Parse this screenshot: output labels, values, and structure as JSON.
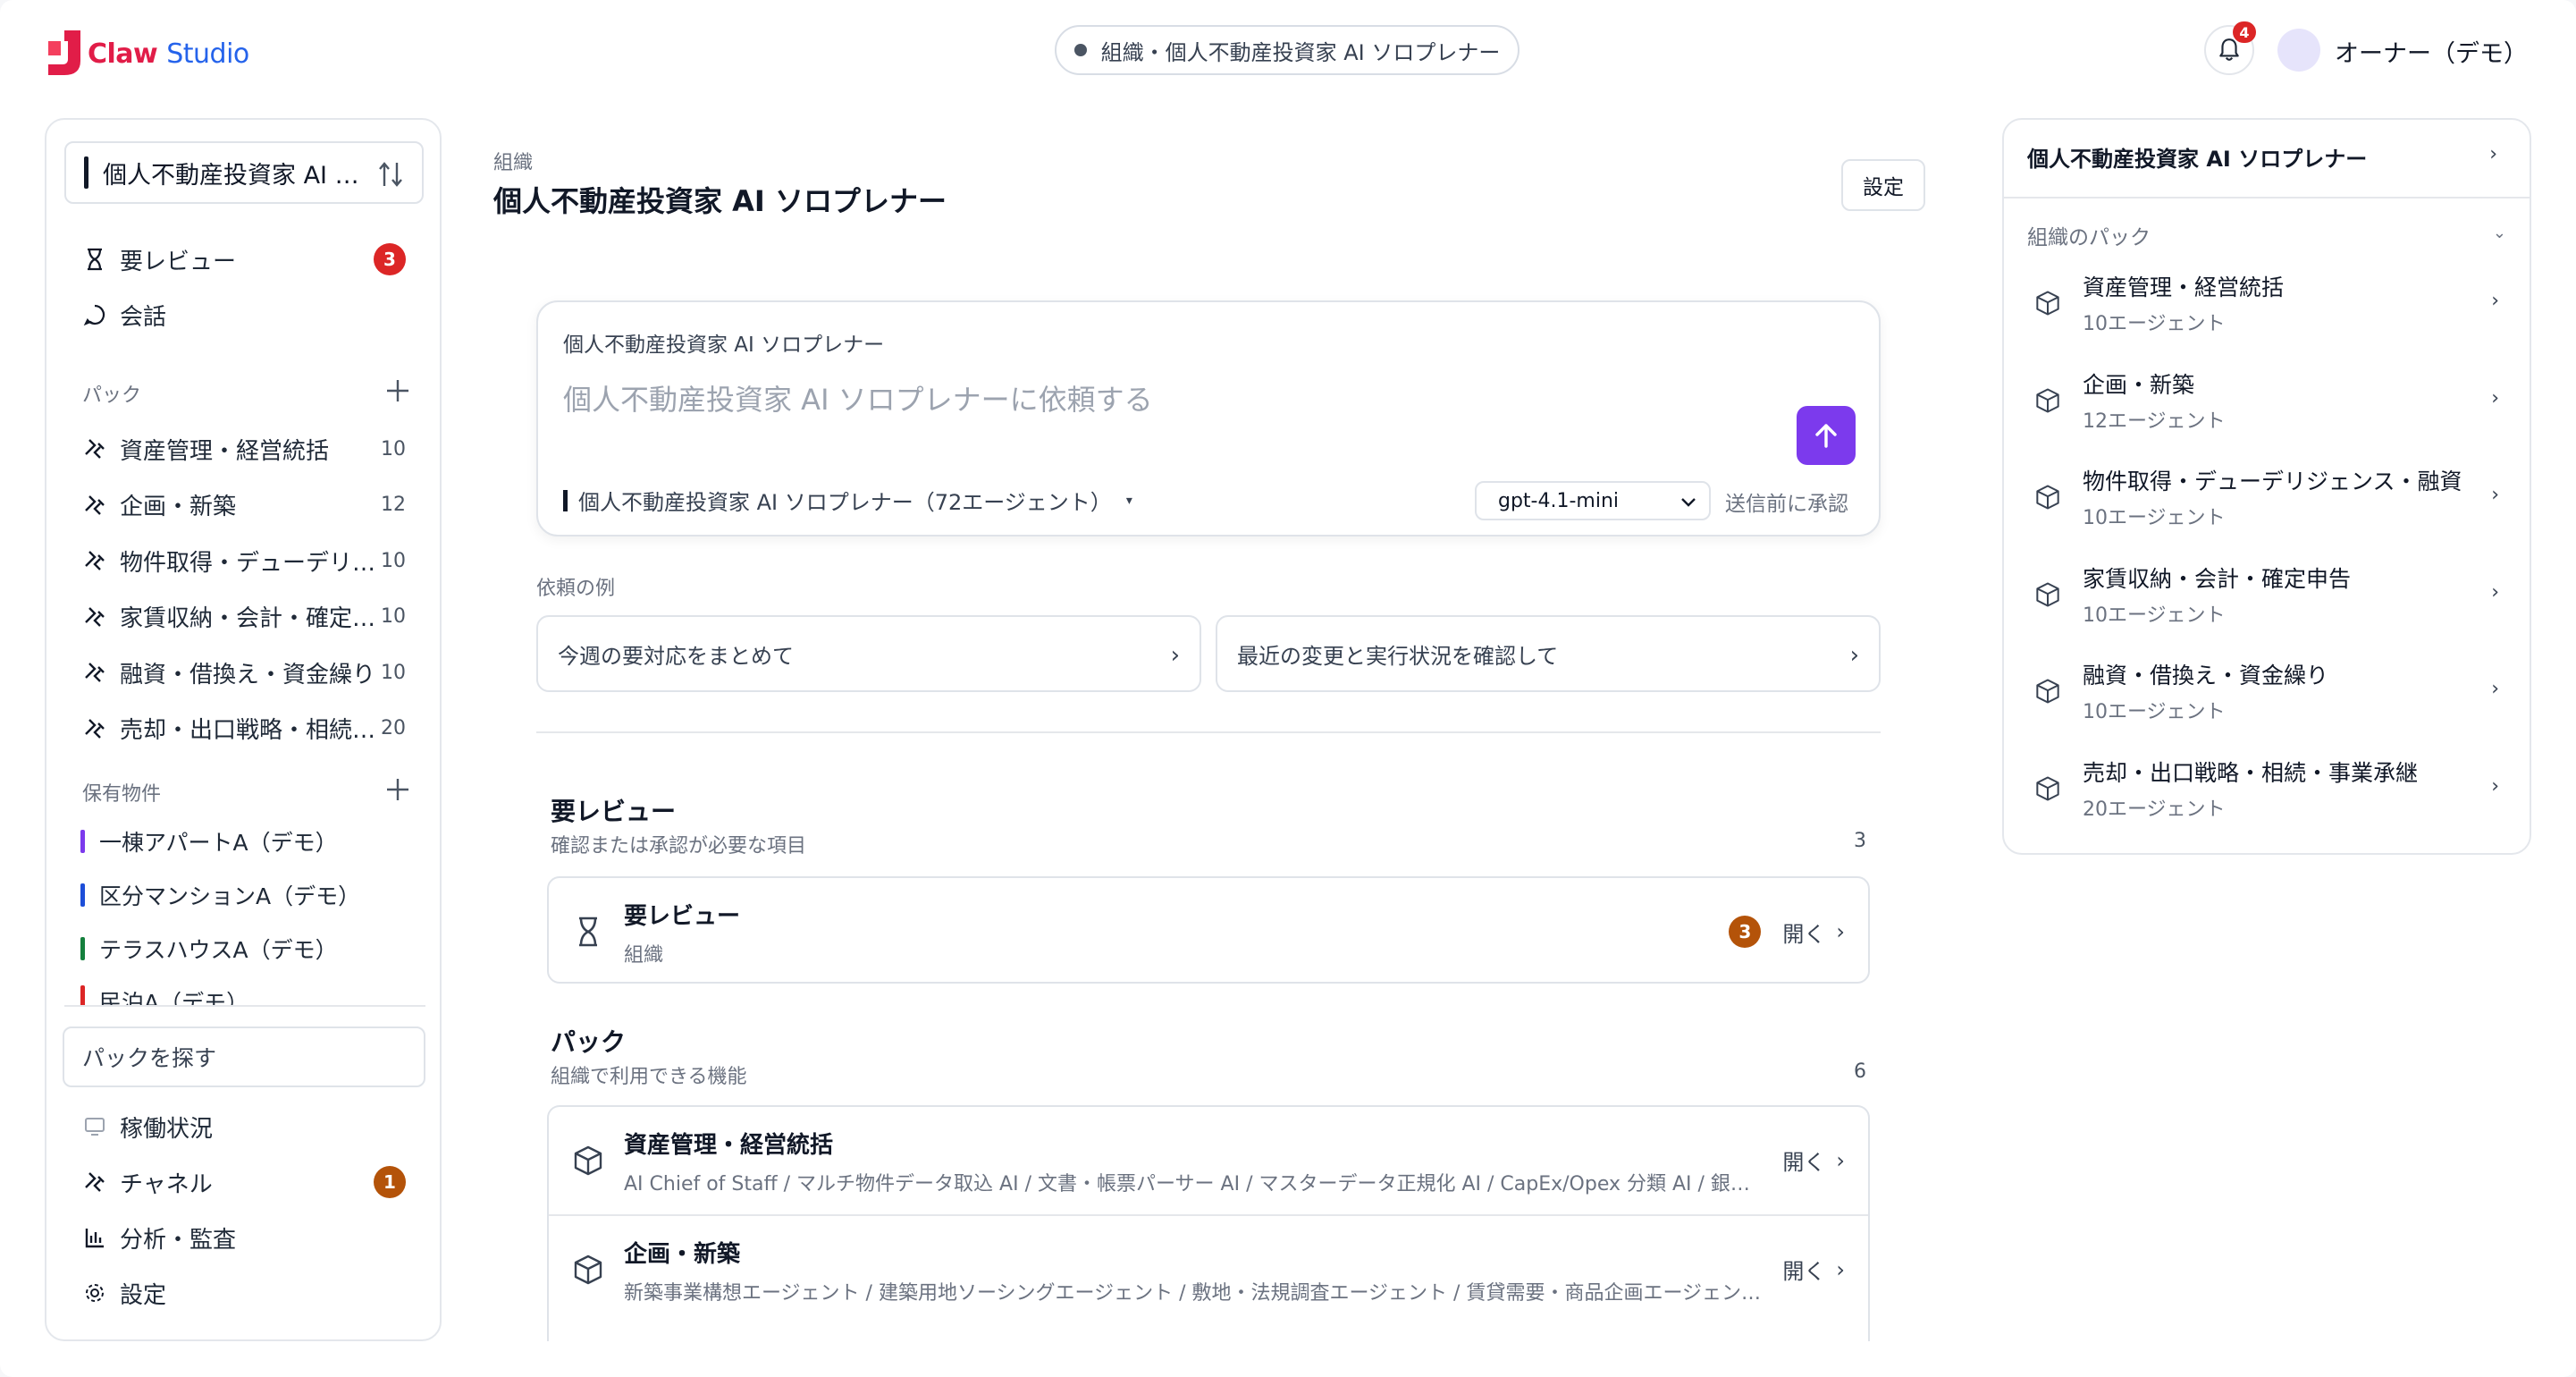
{
  "topbar": {
    "logo_claw": "Claw",
    "logo_studio": "Studio",
    "org_pill": "組織・個人不動産投資家 AI ソロプレナー",
    "bell_count": "4",
    "user_name": "オーナー（デモ）"
  },
  "sidebar": {
    "org_select": "個人不動産投資家 AI ソロプレナー",
    "top_items": [
      {
        "label": "要レビュー",
        "badge": "3"
      },
      {
        "label": "会話"
      }
    ],
    "packs_label": "パック",
    "packs": [
      {
        "label": "資産管理・経営統括",
        "count": "10"
      },
      {
        "label": "企画・新築",
        "count": "12"
      },
      {
        "label": "物件取得・デューデリジェンス・融資",
        "count": "10"
      },
      {
        "label": "家賃収納・会計・確定申告",
        "count": "10"
      },
      {
        "label": "融資・借換え・資金繰り",
        "count": "10"
      },
      {
        "label": "売却・出口戦略・相続・事業承継",
        "count": "20"
      }
    ],
    "props_label": "保有物件",
    "properties": [
      {
        "label": "一棟アパートA（デモ）",
        "color": "#7c3aed"
      },
      {
        "label": "区分マンションA（デモ）",
        "color": "#1d4ed8"
      },
      {
        "label": "テラスハウスA（デモ）",
        "color": "#15803d"
      },
      {
        "label": "民泊A（デモ）",
        "color": "#dc2626"
      }
    ],
    "search_pack": "パックを探す",
    "bottom_items": [
      {
        "label": "稼働状況"
      },
      {
        "label": "チャネル",
        "badge": "1"
      },
      {
        "label": "分析・監査"
      },
      {
        "label": "設定"
      }
    ]
  },
  "main": {
    "breadcrumb": "組織",
    "title": "個人不動産投資家 AI ソロプレナー",
    "settings_label": "設定",
    "composer": {
      "title": "個人不動産投資家 AI ソロプレナー",
      "placeholder": "個人不動産投資家 AI ソロプレナーに依頼する",
      "scope": "個人不動産投資家 AI ソロプレナー（72エージェント）",
      "model": "gpt-4.1-mini",
      "approve": "送信前に承認"
    },
    "examples_label": "依頼の例",
    "examples": [
      "今週の要対応をまとめて",
      "最近の変更と実行状況を確認して"
    ],
    "review": {
      "title": "要レビュー",
      "subtitle": "確認または承認が必要な項目",
      "count": "3",
      "rows": [
        {
          "title": "要レビュー",
          "sub": "組織",
          "badge": "3",
          "open": "開く"
        }
      ]
    },
    "packs": {
      "title": "パック",
      "subtitle": "組織で利用できる機能",
      "count": "6",
      "rows": [
        {
          "title": "資産管理・経営統括",
          "sub": "AI Chief of Staff / マルチ物件データ取込 AI / 文書・帳票パーサー AI / マスターデータ正規化 AI / CapEx/Opex 分類 AI / 銀行・カード取引照合 AI",
          "open": "開く"
        },
        {
          "title": "企画・新築",
          "sub": "新築事業構想エージェント / 建築用地ソーシングエージェント / 敷地・法規調査エージェント / 賃貸需要・商品企画エージェント / 事業収支エージェント",
          "open": "開く"
        }
      ]
    }
  },
  "rpanel": {
    "header": "個人不動産投資家 AI ソロプレナー",
    "section": "組織のパック",
    "items": [
      {
        "title": "資産管理・経営統括",
        "sub": "10エージェント"
      },
      {
        "title": "企画・新築",
        "sub": "12エージェント"
      },
      {
        "title": "物件取得・デューデリジェンス・融資",
        "sub": "10エージェント"
      },
      {
        "title": "家賃収納・会計・確定申告",
        "sub": "10エージェント"
      },
      {
        "title": "融資・借換え・資金繰り",
        "sub": "10エージェント"
      },
      {
        "title": "売却・出口戦略・相続・事業承継",
        "sub": "20エージェント"
      }
    ]
  },
  "colors": {
    "accent": "#7c3aed",
    "badge_red": "#dc2626",
    "badge_brown": "#b45309"
  }
}
